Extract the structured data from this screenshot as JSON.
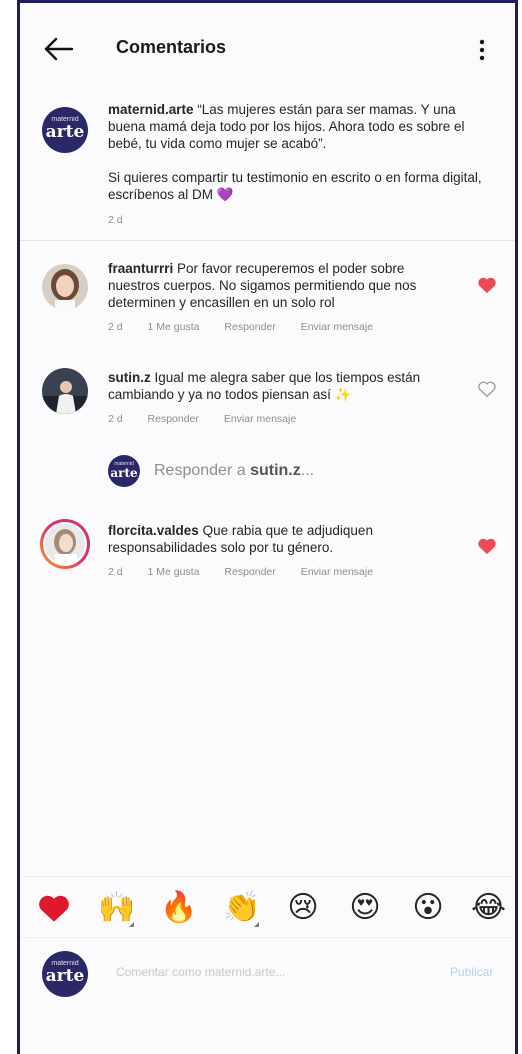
{
  "header": {
    "title": "Comentarios"
  },
  "brand": {
    "logo_small": "maternid",
    "logo_big": "arte"
  },
  "caption": {
    "username": "maternid.arte",
    "text1": "“Las mujeres están para ser mamas. Y una buena mamá deja todo por los hijos. Ahora todo es sobre el bebé, tu vida como mujer se acabó”.",
    "text2": "Si quieres compartir tu testimonio en escrito o en forma digital, escríbenos al DM",
    "heart_emoji": "💜",
    "time": "2 d"
  },
  "comments": [
    {
      "username": "fraanturrri",
      "text": "Por favor recuperemos el poder sobre nuestros cuerpos. No sigamos permitiendo que nos determinen y encasillen en un solo rol",
      "time": "2 d",
      "likes": "1 Me gusta",
      "reply": "Responder",
      "message": "Enviar mensaje",
      "liked": true
    },
    {
      "username": "sutin.z",
      "text": "Igual me alegra saber que los tiempos están cambiando y ya no todos piensan así",
      "emoji": "✨",
      "time": "2 d",
      "reply": "Responder",
      "message": "Enviar mensaje",
      "liked": false
    },
    {
      "username": "florcita.valdes",
      "text": "Que rabia que te adjudiquen responsabilidades solo por tu género.",
      "time": "2 d",
      "likes": "1 Me gusta",
      "reply": "Responder",
      "message": "Enviar mensaje",
      "liked": true
    }
  ],
  "reply_box": {
    "prefix": "Responder a",
    "username": "sutin.z",
    "suffix": "..."
  },
  "emoji_bar": [
    "❤️",
    "🙌",
    "🔥",
    "👏",
    "😢",
    "😍",
    "😮",
    "😂"
  ],
  "composer": {
    "placeholder": "Comentar como maternid.arte...",
    "publish": "Publicar"
  },
  "colors": {
    "like_red": "#ed4956",
    "brand_navy": "#2b2869",
    "frame_navy": "#1f1d5c",
    "link_blue": "#b3d3f5"
  }
}
